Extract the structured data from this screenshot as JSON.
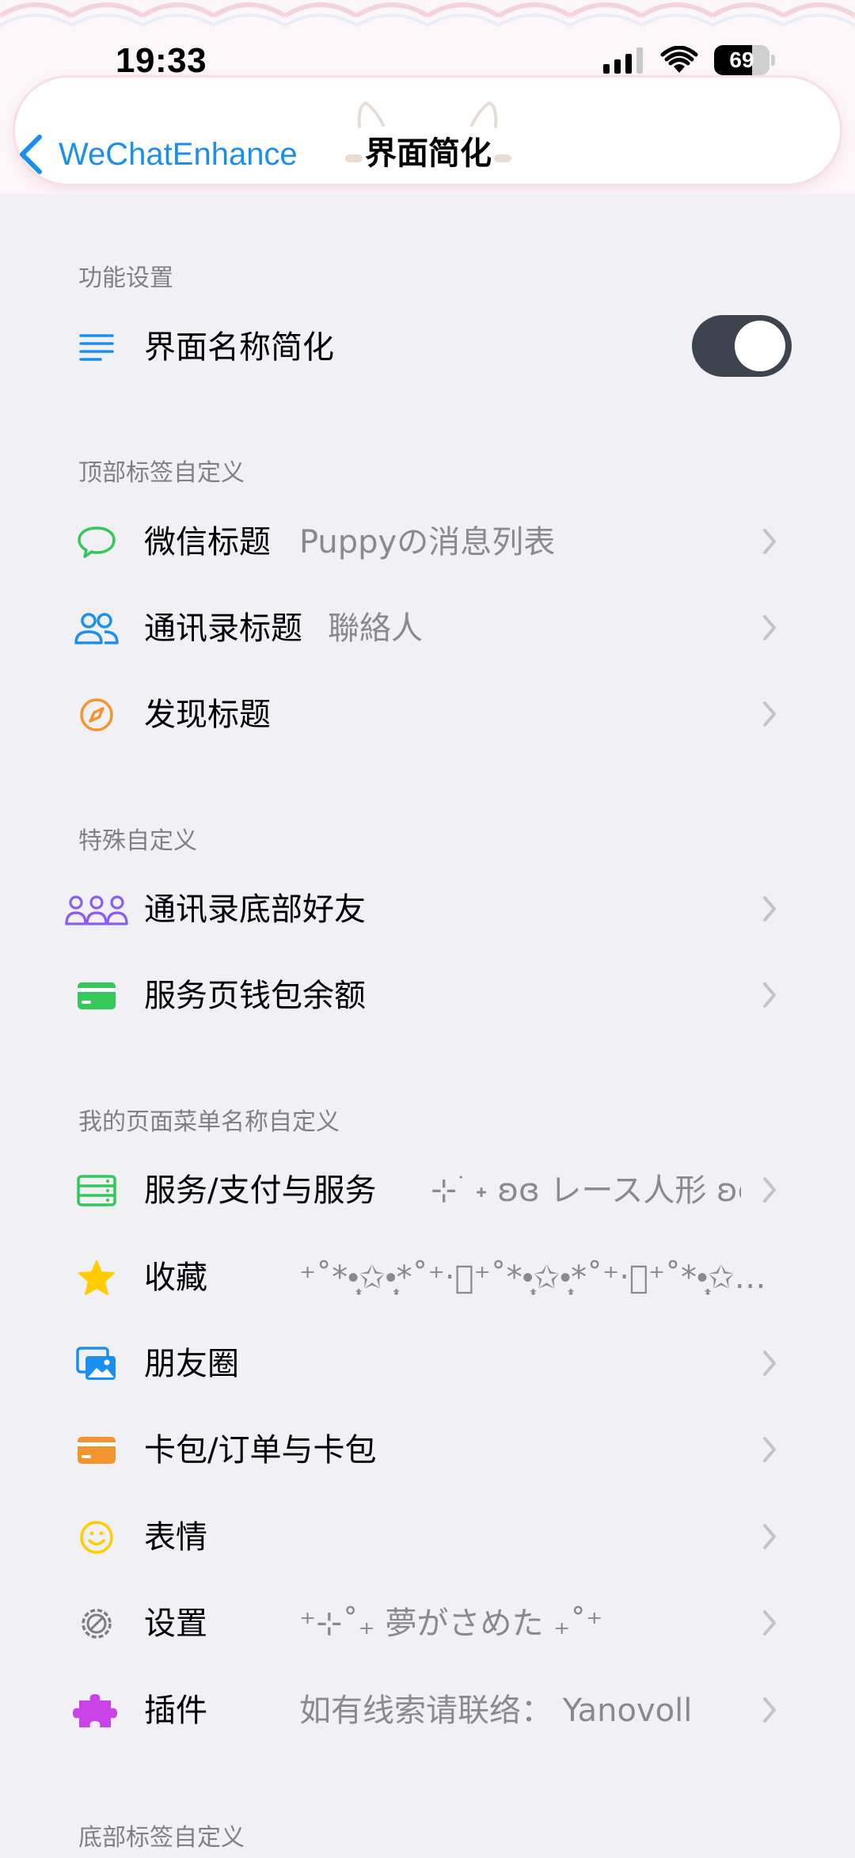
{
  "status_bar": {
    "time": "19:33",
    "battery_level": "69",
    "battery_fraction": 0.69
  },
  "nav": {
    "back_label": "WeChatEnhance",
    "title": "界面简化"
  },
  "sections": [
    {
      "id": "s1",
      "header": "功能设置"
    },
    {
      "id": "s2",
      "header": "顶部标签自定义"
    },
    {
      "id": "s3",
      "header": "特殊自定义"
    },
    {
      "id": "s4",
      "header": "我的页面菜单名称自定义"
    },
    {
      "id": "s5",
      "header": "底部标签自定义"
    }
  ],
  "rows": {
    "name_simplify": {
      "label": "界面名称简化",
      "icon": "list-icon",
      "toggle_on": true
    },
    "wechat_title": {
      "label": "微信标题",
      "value": "Puppyの消息列表",
      "icon": "chat-bubble-icon"
    },
    "contacts_title": {
      "label": "通讯录标题",
      "value": "聯絡人",
      "icon": "people-icon"
    },
    "discover_title": {
      "label": "发现标题",
      "icon": "compass-icon"
    },
    "contacts_bottom_friends": {
      "label": "通讯录底部好友",
      "icon": "group-icon"
    },
    "service_wallet_balance": {
      "label": "服务页钱包余额",
      "icon": "wallet-card-icon"
    },
    "service_payment": {
      "label": "服务/支付与服务",
      "value": "⊹ ࣪ ˖ ʚɞ レース人形 ʚɞ…",
      "icon": "service-icon"
    },
    "favorites": {
      "label": "收藏",
      "value": "⁺˚*•̩̩͙✩•̩̩͙*˚⁺‧͙⁺˚*•̩̩͙✩•̩̩͙*˚⁺‧͙⁺˚*•̩̩͙✩…",
      "icon": "star-icon"
    },
    "moments": {
      "label": "朋友圈",
      "icon": "photos-icon"
    },
    "cards": {
      "label": "卡包/订单与卡包",
      "icon": "card-icon"
    },
    "stickers": {
      "label": "表情",
      "icon": "smiley-icon"
    },
    "settings": {
      "label": "设置",
      "value": "⁺⊹˚₊ 夢がさめた ₊˚⁺",
      "icon": "gear-icon"
    },
    "plugins": {
      "label": "插件",
      "value": "如有线索请联络： Yanovoll",
      "icon": "puzzle-icon"
    }
  },
  "colors": {
    "accent_blue": "#1a8ff0",
    "green": "#34c759",
    "orange": "#f2952f",
    "purple": "#8a5cf6",
    "yellow": "#ffcc00",
    "magenta": "#c844e6",
    "toggle_bg": "#3e4350",
    "background": "#f0f0f5"
  }
}
